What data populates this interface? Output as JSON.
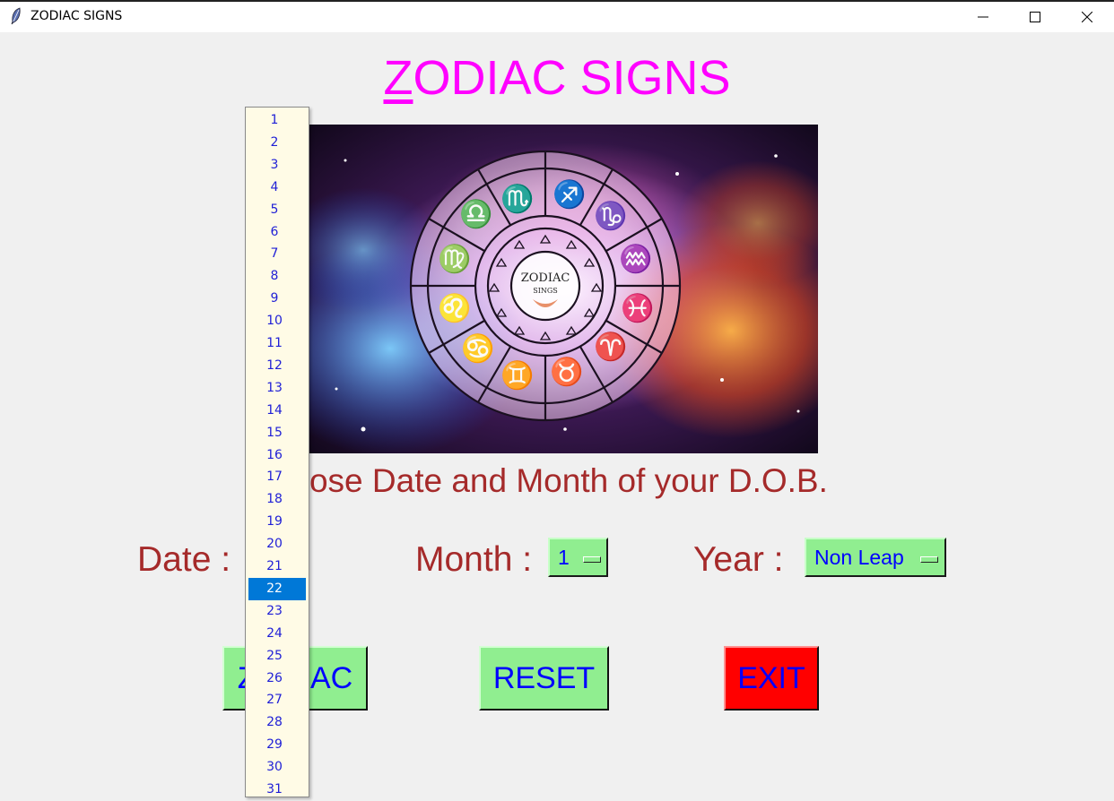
{
  "window": {
    "title": "ZODIAC SIGNS"
  },
  "heading": {
    "first": "Z",
    "rest": "ODIAC SIGNS"
  },
  "banner": {
    "center_title": "ZODIAC",
    "center_sub": "SINGS"
  },
  "prompt": "Choose Date and Month of your D.O.B.",
  "form": {
    "date_label": "Date :",
    "month_label": "Month :",
    "month_value": "1",
    "year_label": "Year :",
    "year_value": "Non Leap"
  },
  "buttons": {
    "zodiac": "ZODIAC",
    "reset": "RESET",
    "exit": "EXIT"
  },
  "date_list": {
    "items": [
      "1",
      "2",
      "3",
      "4",
      "5",
      "6",
      "7",
      "8",
      "9",
      "10",
      "11",
      "12",
      "13",
      "14",
      "15",
      "16",
      "17",
      "18",
      "19",
      "20",
      "21",
      "22",
      "23",
      "24",
      "25",
      "26",
      "27",
      "28",
      "29",
      "30",
      "31"
    ],
    "selected": "22"
  },
  "colors": {
    "heading": "#ff00ff",
    "label": "#a52a2a",
    "button_green": "#90ee90",
    "button_red": "#ff0000",
    "button_text": "#0000ff",
    "highlight": "#0078d7"
  }
}
